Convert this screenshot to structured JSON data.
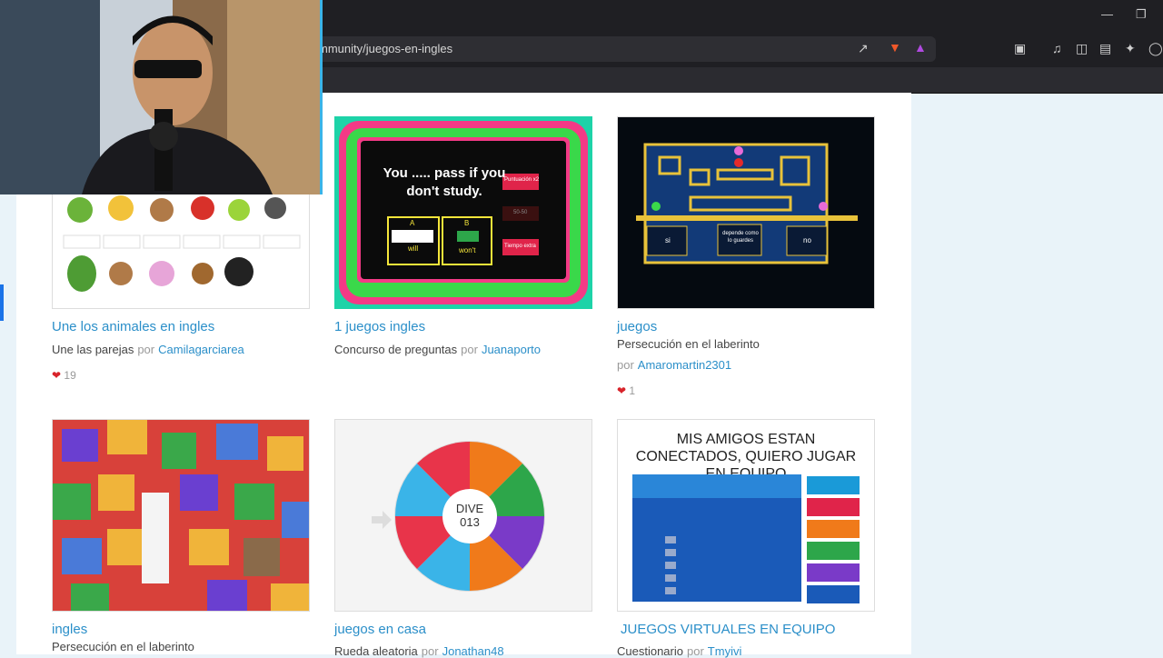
{
  "browser": {
    "url": "mmunity/juegos-en-ingles"
  },
  "cards": [
    {
      "title": "Une los animales en ingles",
      "subtitle": "Une las parejas",
      "por": "por",
      "author": "Camilagarciarea",
      "likes": "19"
    },
    {
      "title": "1 juegos ingles",
      "subtitle": "Concurso de preguntas",
      "por": "por",
      "author": "Juanaporto",
      "likes": ""
    },
    {
      "title": "juegos",
      "subtitle": "Persecución en el laberinto",
      "por": "por",
      "author": "Amaromartin2301",
      "likes": "1"
    },
    {
      "title": "ingles",
      "subtitle": "Persecución en el laberinto",
      "por": "",
      "author": "",
      "likes": ""
    },
    {
      "title": "juegos en casa",
      "subtitle": "Rueda aleatoria",
      "por": "por",
      "author": "Jonathan48",
      "likes": ""
    },
    {
      "title": "JUEGOS VIRTUALES EN EQUIPO",
      "subtitle": "Cuestionario",
      "por": "por",
      "author": "Tmyivi",
      "likes": ""
    }
  ],
  "thumb_quiz": {
    "question": "You ..... pass if you don't study.",
    "a": "A",
    "b": "B",
    "answer_a": "will",
    "answer_b": "won't",
    "side1": "Puntuación x2",
    "side2": "50-50",
    "side3": "Tiempo extra"
  },
  "thumb_maze": {
    "box1": "si",
    "box2": "depende como lo guardes",
    "box3": "no"
  },
  "thumb_wheel": {
    "center": "DIVE 013"
  },
  "thumb_team": {
    "heading": "MIS AMIGOS ESTAN CONECTADOS, QUIERO JUGAR EN EQUIPO"
  }
}
